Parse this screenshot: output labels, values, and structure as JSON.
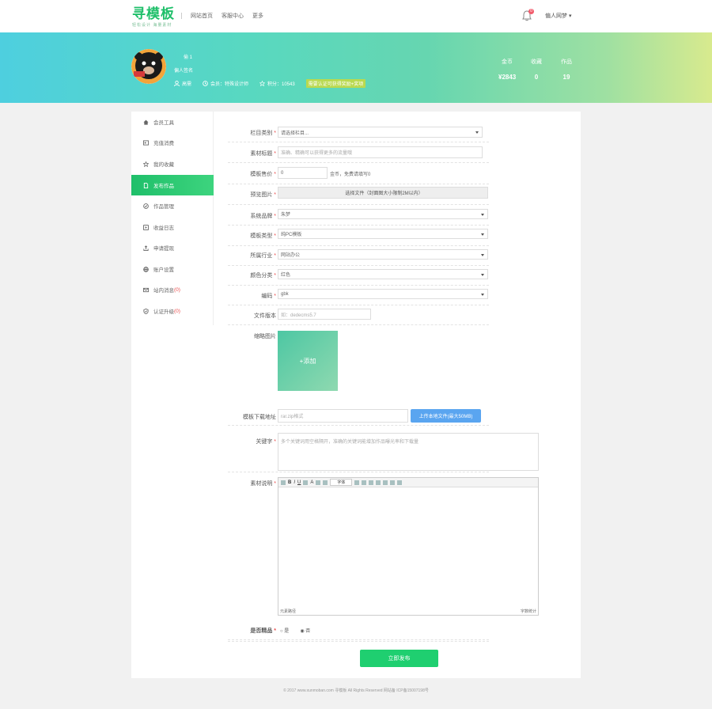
{
  "header": {
    "logo_main": "寻模板",
    "logo_sub": "轻松设计 海量素材",
    "nav": [
      "网站首页",
      "客服中心",
      "更多"
    ],
    "bell_count": "0",
    "user_menu": "偏人网梦 ▾"
  },
  "profile": {
    "name": "  偷 1",
    "sign": "偏人签名",
    "info": [
      {
        "icon": "user-icon",
        "label": "高需"
      },
      {
        "icon": "clock-icon",
        "label": "会员：特殊设计师"
      },
      {
        "icon": "star-icon",
        "label": "积分：10543"
      }
    ],
    "tag": "需要认证可获得奖励+奖项",
    "stats": [
      {
        "label": "金币",
        "value": "¥2843"
      },
      {
        "label": "收藏",
        "value": "0"
      },
      {
        "label": "作品",
        "value": "19"
      }
    ]
  },
  "sidebar": {
    "items": [
      {
        "icon": "home-icon",
        "label": "会员工具"
      },
      {
        "icon": "card-icon",
        "label": "充值消费"
      },
      {
        "icon": "star-icon",
        "label": "我的收藏"
      },
      {
        "icon": "file-icon",
        "label": "发布作品"
      },
      {
        "icon": "check-circle-icon",
        "label": "作品管理"
      },
      {
        "icon": "play-icon",
        "label": "收益日志"
      },
      {
        "icon": "upload-icon",
        "label": "申请提现"
      },
      {
        "icon": "globe-icon",
        "label": "账户设置"
      },
      {
        "icon": "mail-icon",
        "label": "站内消息",
        "badge": "(0)"
      },
      {
        "icon": "shield-icon",
        "label": "认证升级",
        "badge": "(0)"
      }
    ]
  },
  "form": {
    "category": {
      "label": "栏目类别",
      "value": "请选择栏目..."
    },
    "title": {
      "label": "素材标题",
      "placeholder": "准确、精确可以获得更多的流量哦"
    },
    "price": {
      "label": "模板售价",
      "value": "0",
      "hint": "金币，免费请填写0"
    },
    "preview": {
      "label": "预览图片",
      "button": "选择文件（封面图大小限制2M以内）"
    },
    "style": {
      "label": "系统品牌",
      "value": "朱梦"
    },
    "type": {
      "label": "模板类型",
      "value": "纯PC模板"
    },
    "industry": {
      "label": "所属行业",
      "value": "网站办公"
    },
    "color": {
      "label": "颜色分类",
      "value": "红色"
    },
    "encoding": {
      "label": "编码",
      "value": "gbk"
    },
    "version": {
      "label": "文件版本",
      "placeholder": "如：dedecms5.7"
    },
    "thumb": {
      "label": "缩略图片",
      "add": "+添加"
    },
    "download": {
      "label": "模板下载地址",
      "placeholder": "rar.zip格式",
      "button": "上传本地文件(最大50MB)"
    },
    "keywords": {
      "label": "关键字",
      "placeholder": "多个关键词用空格隔开，准确的关键词能增加作品曝光率和下载量"
    },
    "desc": {
      "label": "素材说明",
      "toolbar_font": "字体",
      "footer_left": "元素路径",
      "footer_right": "字数统计"
    },
    "featured": {
      "label": "是否精品",
      "yes": "是",
      "no": "否"
    },
    "submit": "立即发布"
  },
  "footer": "© 2017 www.xunmoban.com 寻模板 All Rights Reserved 网站备 ICP备15007198号"
}
